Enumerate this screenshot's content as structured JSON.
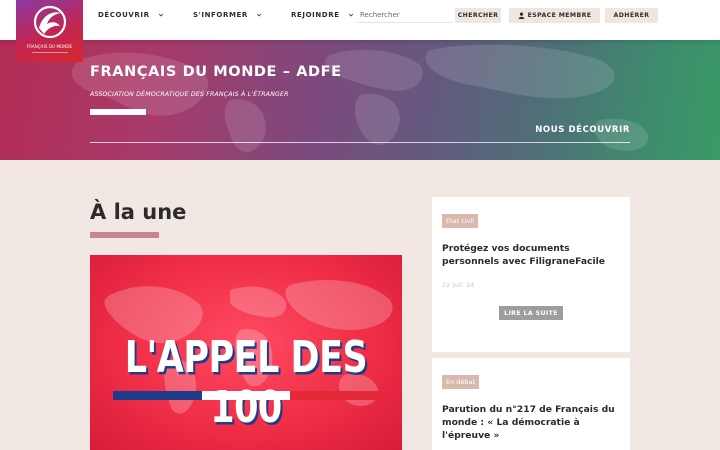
{
  "header": {
    "logo_text": "FRANÇAIS DU MONDE",
    "nav": [
      {
        "label": "DÉCOUVRIR"
      },
      {
        "label": "S'INFORMER"
      },
      {
        "label": "REJOINDRE"
      }
    ],
    "search_placeholder": "Rechercher",
    "search_button": "CHERCHER",
    "member_button": "ESPACE MEMBRE",
    "join_button": "ADHÉRER"
  },
  "hero": {
    "title": "FRANÇAIS DU MONDE – ADFE",
    "subtitle": "ASSOCIATION DÉMOCRATIQUE DES FRANÇAIS À L'ÉTRANGER",
    "link": "NOUS DÉCOUVRIR",
    "gradient_colors": [
      "#b22c55",
      "#7b4a7e",
      "#3a9a66"
    ]
  },
  "main": {
    "section_title": "À la une",
    "feature": {
      "headline": "L'APPEL DES 100",
      "flag_colors": [
        "#1f3c8a",
        "#ffffff",
        "#e3283a"
      ]
    },
    "cards": [
      {
        "category": "Etat civil",
        "title": "Protégez vos documents personnels avec FiligraneFacile",
        "date": "22 juil. 24",
        "button": "LIRE LA SUITE"
      },
      {
        "category": "En débat",
        "title": "Parution du n°217 de Français du monde : « La démocratie à l'épreuve »"
      }
    ]
  },
  "colors": {
    "page_bg": "#f1e8e3",
    "accent_bar": "#c9858b",
    "category_badge": "#d9b8ad"
  }
}
